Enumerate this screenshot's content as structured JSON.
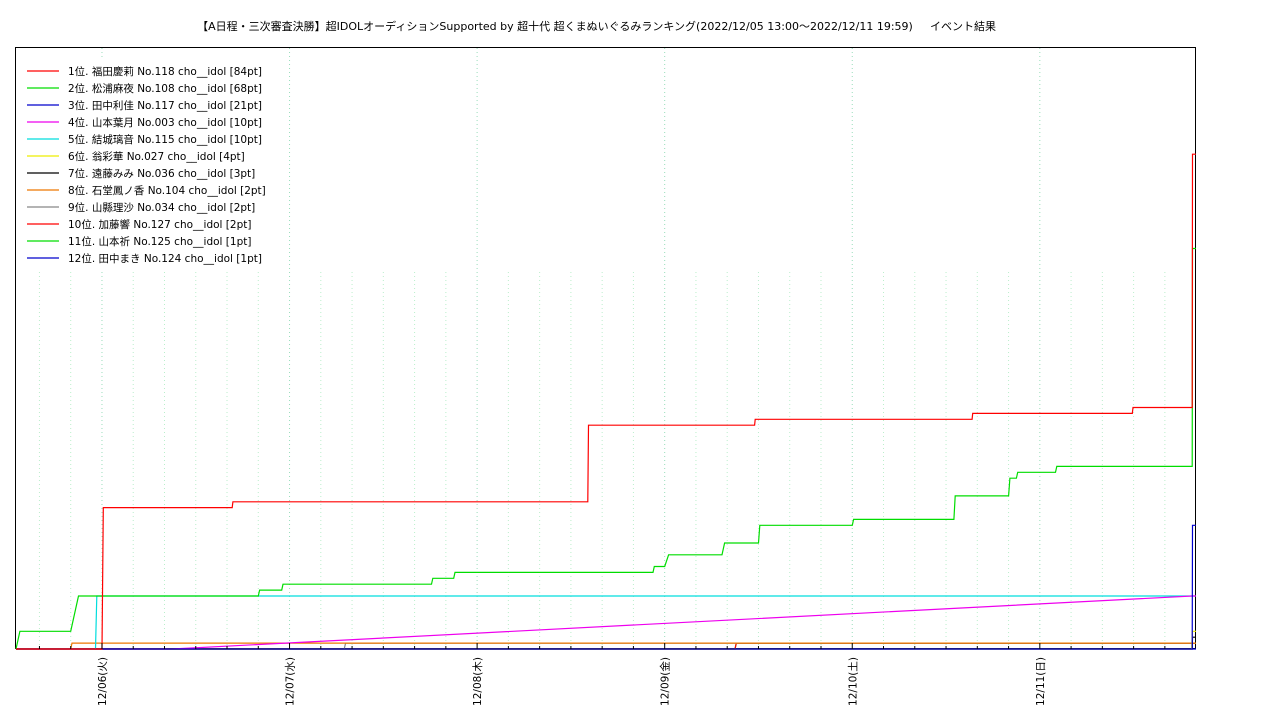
{
  "chart_data": {
    "type": "line",
    "title": "【A日程・三次審査決勝】超IDOLオーディションSupported by 超十代 超くまぬいぐるみランキング(2022/12/05 13:00〜2022/12/11 19:59)",
    "subtitle": "イベント結果",
    "xlabel": "",
    "ylabel": "",
    "x_range": [
      "2022-12-05 13:00",
      "2022-12-11 19:59"
    ],
    "ylim": [
      0,
      100
    ],
    "grid": true,
    "legend_position": "top-left",
    "x_ticks": [
      {
        "at": "2022-12-06 00:00",
        "label": "12/06(火)"
      },
      {
        "at": "2022-12-07 00:00",
        "label": "12/07(水)"
      },
      {
        "at": "2022-12-08 00:00",
        "label": "12/08(木)"
      },
      {
        "at": "2022-12-09 00:00",
        "label": "12/09(金)"
      },
      {
        "at": "2022-12-10 00:00",
        "label": "12/10(土)"
      },
      {
        "at": "2022-12-11 00:00",
        "label": "12/11(日)"
      }
    ],
    "series": [
      {
        "name": "1位. 福田慶莉 No.118 cho__idol [84pt]",
        "color": "#ff0000",
        "points": [
          [
            "2022-12-05 13:00",
            0
          ],
          [
            "2022-12-06 00:00",
            0
          ],
          [
            "2022-12-06 00:10",
            24
          ],
          [
            "2022-12-06 16:40",
            24
          ],
          [
            "2022-12-06 16:45",
            25
          ],
          [
            "2022-12-08 14:10",
            25
          ],
          [
            "2022-12-08 14:15",
            38
          ],
          [
            "2022-12-09 11:30",
            38
          ],
          [
            "2022-12-09 11:35",
            39
          ],
          [
            "2022-12-10 15:20",
            39
          ],
          [
            "2022-12-10 15:25",
            40
          ],
          [
            "2022-12-11 11:50",
            40
          ],
          [
            "2022-12-11 11:55",
            41
          ],
          [
            "2022-12-11 19:30",
            41
          ],
          [
            "2022-12-11 19:32",
            84
          ],
          [
            "2022-12-11 19:59",
            84
          ]
        ]
      },
      {
        "name": "2位. 松浦麻夜 No.108 cho__idol [68pt]",
        "color": "#00dd00",
        "points": [
          [
            "2022-12-05 13:00",
            0
          ],
          [
            "2022-12-05 13:30",
            3
          ],
          [
            "2022-12-05 20:00",
            3
          ],
          [
            "2022-12-05 20:40",
            7
          ],
          [
            "2022-12-05 21:00",
            9
          ],
          [
            "2022-12-06 20:00",
            9
          ],
          [
            "2022-12-06 20:10",
            10
          ],
          [
            "2022-12-06 23:00",
            10
          ],
          [
            "2022-12-06 23:10",
            11
          ],
          [
            "2022-12-07 18:10",
            11
          ],
          [
            "2022-12-07 18:20",
            12
          ],
          [
            "2022-12-07 21:00",
            12
          ],
          [
            "2022-12-07 21:10",
            13
          ],
          [
            "2022-12-08 22:30",
            13
          ],
          [
            "2022-12-08 22:40",
            14
          ],
          [
            "2022-12-09 00:00",
            14
          ],
          [
            "2022-12-09 00:30",
            16
          ],
          [
            "2022-12-09 07:20",
            16
          ],
          [
            "2022-12-09 07:30",
            17
          ],
          [
            "2022-12-09 07:40",
            18
          ],
          [
            "2022-12-09 12:00",
            18
          ],
          [
            "2022-12-09 12:10",
            21
          ],
          [
            "2022-12-10 00:00",
            21
          ],
          [
            "2022-12-10 00:10",
            22
          ],
          [
            "2022-12-10 13:00",
            22
          ],
          [
            "2022-12-10 13:10",
            26
          ],
          [
            "2022-12-10 20:00",
            26
          ],
          [
            "2022-12-10 20:10",
            29
          ],
          [
            "2022-12-10 21:00",
            29
          ],
          [
            "2022-12-10 21:10",
            30
          ],
          [
            "2022-12-11 02:00",
            30
          ],
          [
            "2022-12-11 02:10",
            31
          ],
          [
            "2022-12-11 19:30",
            31
          ],
          [
            "2022-12-11 19:32",
            68
          ],
          [
            "2022-12-11 19:59",
            68
          ]
        ]
      },
      {
        "name": "3位. 田中利佳 No.117 cho__idol [21pt]",
        "color": "#0000cc",
        "points": [
          [
            "2022-12-05 13:00",
            0
          ],
          [
            "2022-12-11 19:30",
            0
          ],
          [
            "2022-12-11 19:32",
            21
          ],
          [
            "2022-12-11 19:59",
            21
          ]
        ]
      },
      {
        "name": "4位. 山本葉月 No.003 cho__idol [10pt]",
        "color": "#ee00ee",
        "points": [
          [
            "2022-12-05 13:00",
            0
          ],
          [
            "2022-12-06 09:00",
            0
          ],
          [
            "2022-12-11 19:30",
            9
          ],
          [
            "2022-12-11 19:59",
            9
          ]
        ]
      },
      {
        "name": "5位. 結城璃音 No.115 cho__idol [10pt]",
        "color": "#00dddd",
        "points": [
          [
            "2022-12-05 13:00",
            0
          ],
          [
            "2022-12-05 23:10",
            0
          ],
          [
            "2022-12-05 23:20",
            9
          ],
          [
            "2022-12-11 19:59",
            9
          ]
        ]
      },
      {
        "name": "6位. 翁彩華 No.027 cho__idol [4pt]",
        "color": "#eeee00",
        "points": [
          [
            "2022-12-05 13:00",
            0
          ],
          [
            "2022-12-11 19:25",
            0
          ],
          [
            "2022-12-11 19:32",
            3
          ],
          [
            "2022-12-11 19:59",
            3
          ]
        ]
      },
      {
        "name": "7位. 遠藤みみ No.036 cho__idol [3pt]",
        "color": "#000000",
        "points": [
          [
            "2022-12-05 13:00",
            0
          ],
          [
            "2022-12-11 19:30",
            0
          ],
          [
            "2022-12-11 19:32",
            2
          ],
          [
            "2022-12-11 19:59",
            2
          ]
        ]
      },
      {
        "name": "8位. 石堂鳳ノ香 No.104 cho__idol [2pt]",
        "color": "#ee7700",
        "points": [
          [
            "2022-12-05 13:00",
            0
          ],
          [
            "2022-12-05 20:00",
            0
          ],
          [
            "2022-12-05 20:10",
            1
          ],
          [
            "2022-12-11 19:59",
            1
          ]
        ]
      },
      {
        "name": "9位. 山縣理沙 No.034 cho__idol [2pt]",
        "color": "#888888",
        "points": [
          [
            "2022-12-05 13:00",
            0
          ],
          [
            "2022-12-07 07:00",
            0
          ],
          [
            "2022-12-07 07:10",
            1
          ],
          [
            "2022-12-11 19:59",
            1
          ]
        ]
      },
      {
        "name": "10位. 加藤響 No.127 cho__idol [2pt]",
        "color": "#ff0000",
        "points": [
          [
            "2022-12-05 13:00",
            0
          ],
          [
            "2022-12-09 09:00",
            0
          ],
          [
            "2022-12-09 09:10",
            1
          ],
          [
            "2022-12-11 19:59",
            1
          ]
        ]
      },
      {
        "name": "11位. 山本祈 No.125 cho__idol [1pt]",
        "color": "#00dd00",
        "points": [
          [
            "2022-12-05 13:00",
            0
          ],
          [
            "2022-12-09 09:00",
            0
          ],
          [
            "2022-12-09 09:10",
            1
          ],
          [
            "2022-12-11 19:59",
            1
          ]
        ]
      },
      {
        "name": "12位. 田中まき No.124 cho__idol [1pt]",
        "color": "#0000cc",
        "points": [
          [
            "2022-12-05 13:00",
            0
          ],
          [
            "2022-12-11 19:59",
            0
          ]
        ]
      }
    ]
  }
}
